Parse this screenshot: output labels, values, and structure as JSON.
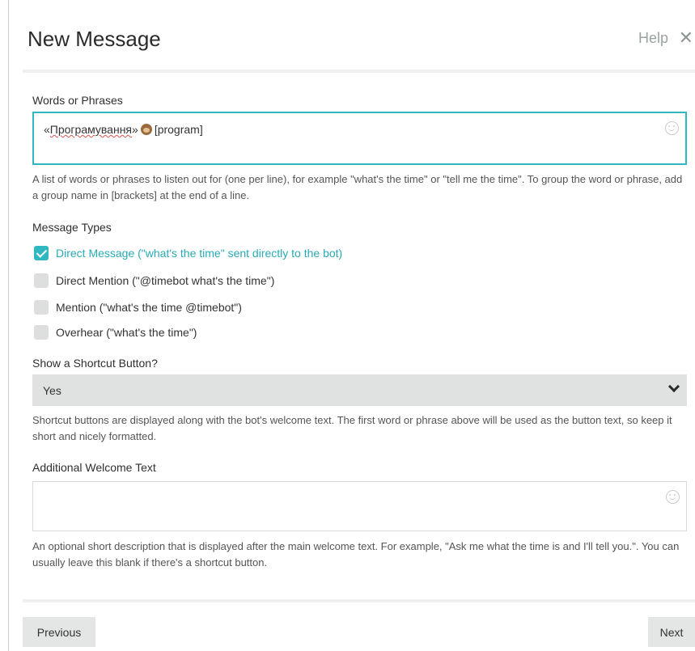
{
  "modal": {
    "title": "New Message",
    "help_label": "Help",
    "close_symbol": "✕"
  },
  "words": {
    "label": "Words or Phrases",
    "quote_open": "«",
    "misspelled_word": "Програмування",
    "quote_close": "»",
    "emoji": "monkey-face-emoji",
    "group_tag": "[program]",
    "hint": "A list of words or phrases to listen out for (one per line), for example \"what's the time\" or \"tell me the time\". To group the word or phrase, add a group name in [brackets] at the end of a line."
  },
  "message_types": {
    "label": "Message Types",
    "options": [
      {
        "label": "Direct Message (\"what's the time\" sent directly to the bot)",
        "checked": true
      },
      {
        "label": "Direct Mention (\"@timebot what's the time\")",
        "checked": false
      },
      {
        "label": "Mention (\"what's the time @timebot\")",
        "checked": false
      },
      {
        "label": "Overhear (\"what's the time\")",
        "checked": false
      }
    ]
  },
  "shortcut": {
    "label": "Show a Shortcut Button?",
    "selected": "Yes",
    "hint": "Shortcut buttons are displayed along with the bot's welcome text. The first word or phrase above will be used as the button text, so keep it short and nicely formatted."
  },
  "welcome": {
    "label": "Additional Welcome Text",
    "value": "",
    "hint": "An optional short description that is displayed after the main welcome text. For example, \"Ask me what the time is and I'll tell you.\". You can usually leave this blank if there's a shortcut button."
  },
  "footer": {
    "previous_label": "Previous",
    "next_label": "Next"
  },
  "colors": {
    "accent": "#31b7c0",
    "accent_text": "#2aaab4",
    "control_bg": "#dfe2e1"
  }
}
